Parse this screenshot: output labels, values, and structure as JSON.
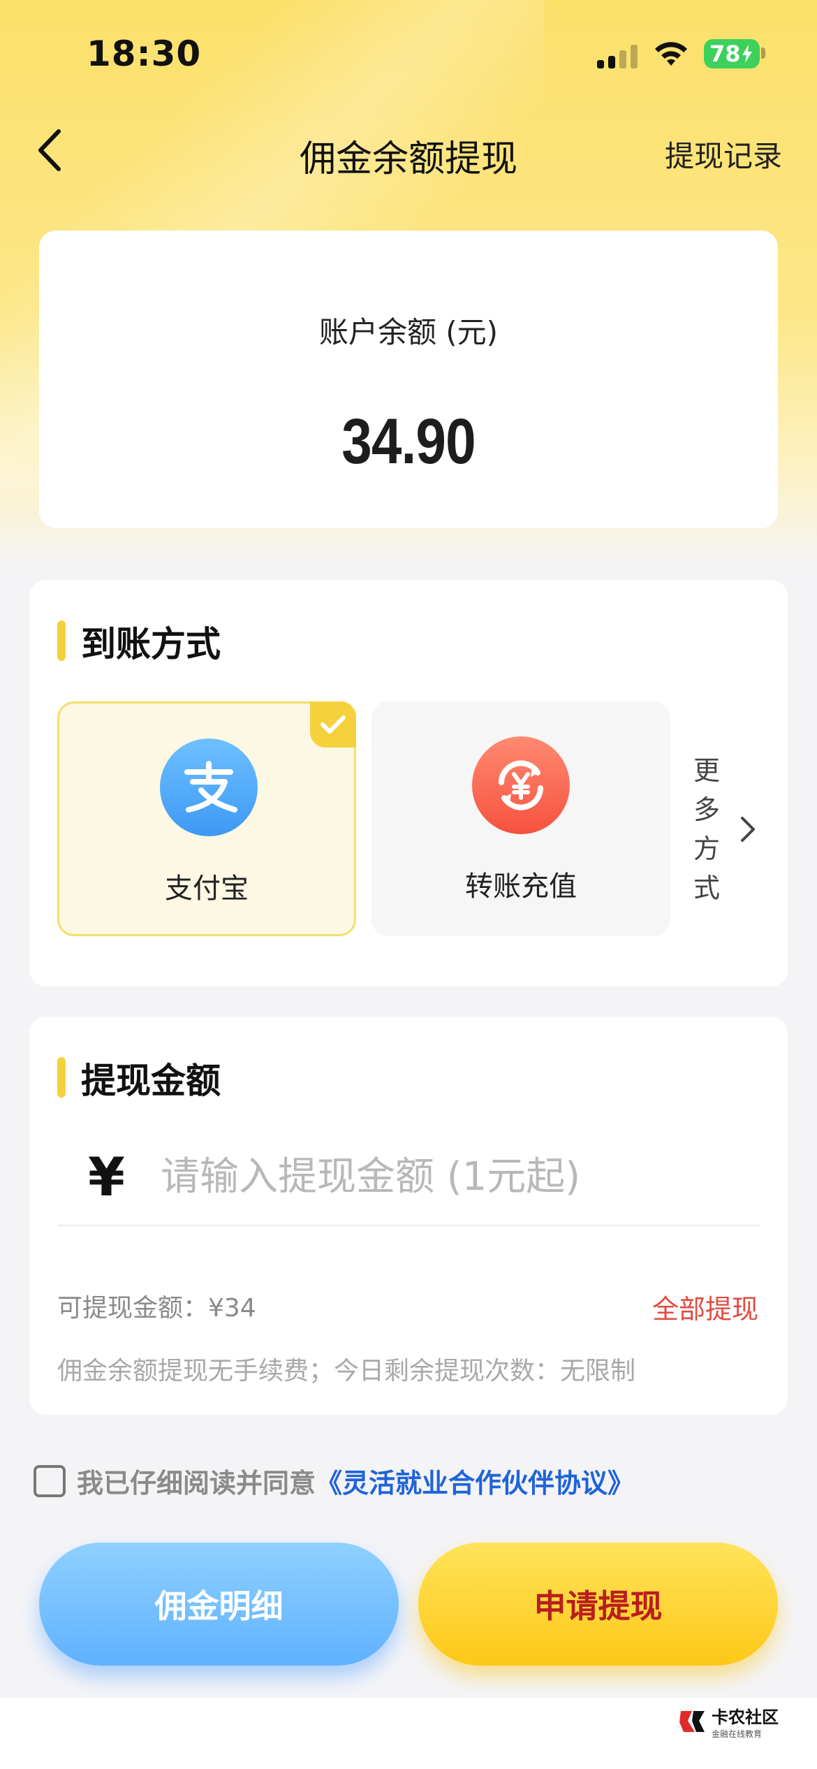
{
  "status_bar": {
    "time": "18:30",
    "battery": "78"
  },
  "header": {
    "title": "佣金余额提现",
    "record_link": "提现记录"
  },
  "balance": {
    "label": "账户余额 (元)",
    "value": "34.90"
  },
  "payout_method": {
    "title": "到账方式",
    "options": [
      {
        "label": "支付宝",
        "selected": true,
        "color": "#4da8ff"
      },
      {
        "label": "转账充值",
        "selected": false,
        "color": "#ff6655"
      }
    ],
    "more_label": "更多方式",
    "more_chars": [
      "更",
      "多",
      "方",
      "式"
    ]
  },
  "withdraw_amount": {
    "title": "提现金额",
    "currency_symbol": "¥",
    "input_value": "",
    "input_placeholder": "请输入提现金额 (1元起)",
    "available_text": "可提现金额：¥34",
    "withdraw_all_label": "全部提现",
    "fee_note": "佣金余额提现无手续费；今日剩余提现次数：无限制"
  },
  "agreement": {
    "prefix": "我已仔细阅读并同意",
    "link": "《灵活就业合作伙伴协议》",
    "checked": false
  },
  "buttons": {
    "detail_label": "佣金明细",
    "apply_label": "申请提现"
  },
  "watermark": {
    "title": "卡农社区",
    "subtitle": "金融在线教育"
  },
  "colors": {
    "accent_yellow": "#f5d23d",
    "link_blue": "#1f63d9",
    "alert_red": "#e14b3f"
  }
}
